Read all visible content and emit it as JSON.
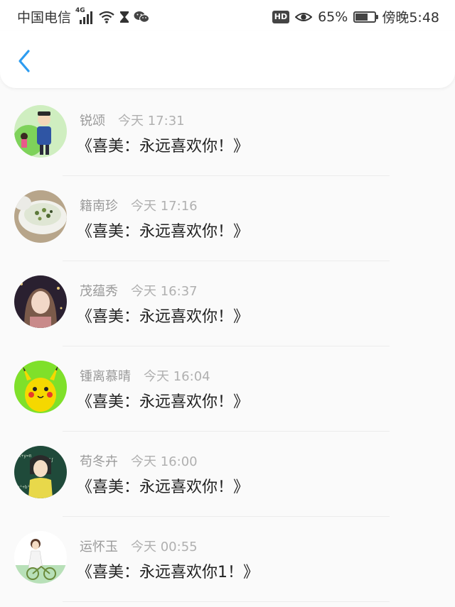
{
  "status_bar": {
    "carrier": "中国电信",
    "network": "4G",
    "hd_badge": "HD",
    "battery_percent": "65%",
    "battery_level": 0.65,
    "time": "傍晚5:48"
  },
  "header": {
    "back_icon": "chevron-left-icon"
  },
  "messages": [
    {
      "name": "锐颂",
      "time": "今天 17:31",
      "text": "《喜美：永远喜欢你！》"
    },
    {
      "name": "籍南珍",
      "time": "今天 17:16",
      "text": "《喜美：永远喜欢你！》"
    },
    {
      "name": "茂蕴秀",
      "time": "今天 16:37",
      "text": "《喜美：永远喜欢你！》"
    },
    {
      "name": "锺离慕晴",
      "time": "今天 16:04",
      "text": "《喜美：永远喜欢你！》"
    },
    {
      "name": "苟冬卉",
      "time": "今天 16:00",
      "text": "《喜美：永远喜欢你！》"
    },
    {
      "name": "运怀玉",
      "time": "今天 00:55",
      "text": "《喜美：永远喜欢你1！》"
    }
  ],
  "colors": {
    "accent": "#2d9cf0",
    "name_text": "#9a9a9a",
    "time_text": "#b0b0b0",
    "message_text": "#222222"
  }
}
